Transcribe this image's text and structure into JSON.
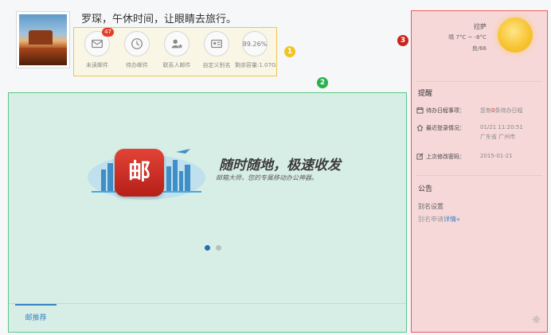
{
  "profile": {
    "greeting": "罗琛，午休时间，让眼睛去旅行。"
  },
  "quick_panel": {
    "items": [
      {
        "label": "未读邮件",
        "icon": "mail-icon",
        "badge": "47"
      },
      {
        "label": "待办邮件",
        "icon": "clock-icon"
      },
      {
        "label": "联系人邮件",
        "icon": "contact-star-icon"
      },
      {
        "label": "自定义别名",
        "icon": "id-card-icon"
      },
      {
        "label": "剩余容量:1.07G",
        "value": "89.26%"
      }
    ]
  },
  "markers": [
    "1",
    "2",
    "3"
  ],
  "promo": {
    "app_icon_char": "邮",
    "title": "随时随地，极速收发",
    "subtitle": "邮箱大师，您的专属移动办公神器。",
    "slides_total": 2,
    "slide_active": 1,
    "tab": "邮推荐"
  },
  "weather": {
    "city": "拉萨",
    "temp": "晴 7°C ~ -8°C",
    "aqi": "良/66",
    "icon": "sun-icon"
  },
  "reminder": {
    "title": "提醒",
    "items": [
      {
        "icon": "calendar-icon",
        "label": "待办日程事项：",
        "value_prefix": "您有",
        "value_highlight": "0",
        "value_suffix": "条待办日程"
      },
      {
        "icon": "home-icon",
        "label": "最近登录情况：",
        "value_line1": "01/21 11:20:51",
        "value_line2": "广东省 广州市"
      },
      {
        "icon": "edit-icon",
        "label": "上次修改密码：",
        "value": "2015-01-21"
      }
    ]
  },
  "notice": {
    "title": "公告",
    "sub_title": "别名设置",
    "line_prefix": "别名申请",
    "link": "详情",
    "link_suffix": "»"
  }
}
